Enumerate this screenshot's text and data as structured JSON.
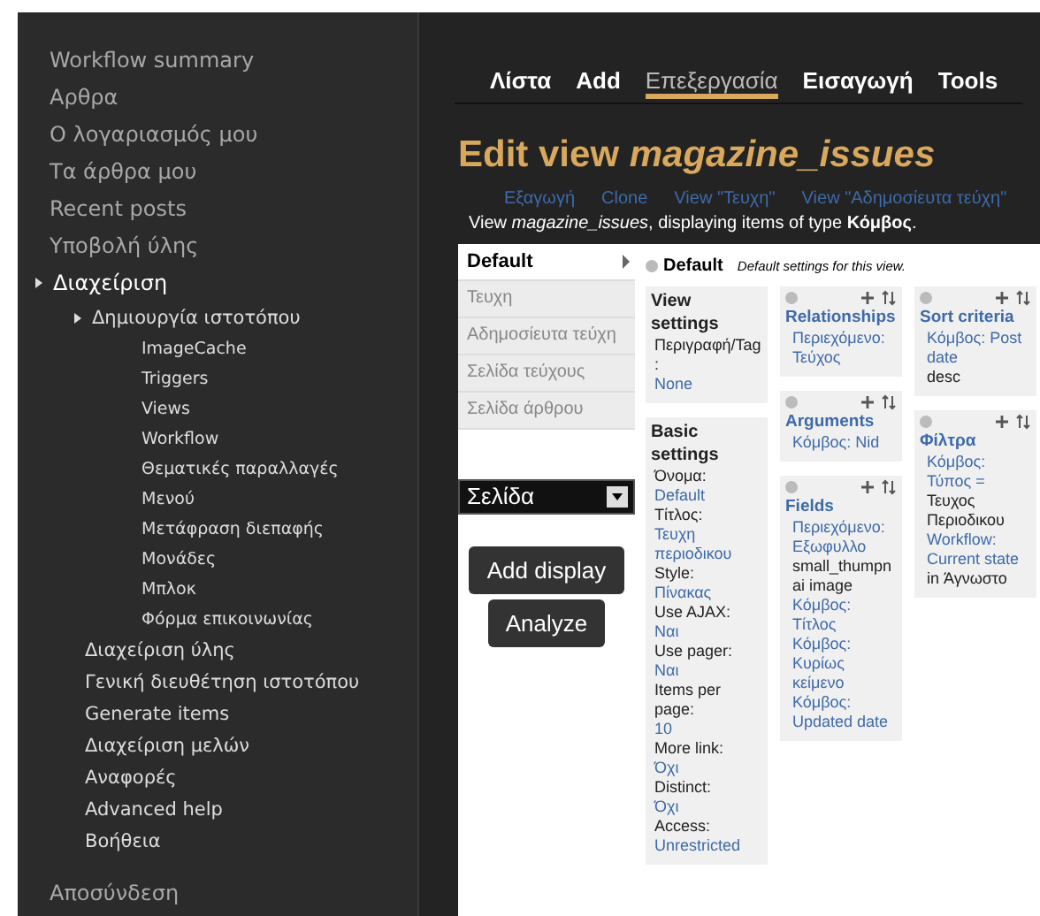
{
  "sidebar": {
    "items": [
      {
        "label": "Workflow summary"
      },
      {
        "label": "Αρθρα"
      },
      {
        "label": "Ο λογαριασμός μου"
      },
      {
        "label": "Τα άρθρα μου"
      },
      {
        "label": "Recent posts"
      },
      {
        "label": "Υποβολή ύλης"
      },
      {
        "label": "Διαχείριση",
        "children": [
          {
            "label": "Δημιουργία ιστοτόπου",
            "children": [
              {
                "label": "ImageCache"
              },
              {
                "label": "Triggers"
              },
              {
                "label": "Views"
              },
              {
                "label": "Workflow"
              },
              {
                "label": "Θεματικές παραλλαγές"
              },
              {
                "label": "Μενού"
              },
              {
                "label": "Μετάφραση διεπαφής"
              },
              {
                "label": "Μονάδες"
              },
              {
                "label": "Μπλοκ"
              },
              {
                "label": "Φόρμα επικοινωνίας"
              }
            ]
          },
          {
            "label": "Διαχείριση ύλης"
          },
          {
            "label": "Γενική διευθέτηση ιστοτόπου"
          },
          {
            "label": "Generate items"
          },
          {
            "label": "Διαχείριση μελών"
          },
          {
            "label": "Αναφορές"
          },
          {
            "label": "Advanced help"
          },
          {
            "label": "Βοήθεια"
          }
        ]
      },
      {
        "label": "Αποσύνδεση"
      }
    ]
  },
  "tabs": [
    {
      "label": "Λίστα",
      "selected": false
    },
    {
      "label": "Add",
      "selected": false
    },
    {
      "label": "Επεξεργασία",
      "selected": true
    },
    {
      "label": "Εισαγωγή",
      "selected": false
    },
    {
      "label": "Tools",
      "selected": false
    }
  ],
  "title": "Edit view *magazine_issues*",
  "links": [
    "Εξαγωγή",
    "Clone",
    "View \"Τευχη\"",
    "View \"Αδημοσίευτα τεύχη\""
  ],
  "description": "View *magazine_issues*, displaying items of type **Κόμβος**.",
  "displays": [
    {
      "label": "Default",
      "selected": true
    },
    {
      "label": "Τευχη",
      "selected": false
    },
    {
      "label": "Αδημοσίευτα τεύχη",
      "selected": false
    },
    {
      "label": "Σελίδα τεύχους",
      "selected": false
    },
    {
      "label": "Σελίδα άρθρου",
      "selected": false
    }
  ],
  "display_type": "Σελίδα",
  "buttons": [
    "Add display",
    "Analyze"
  ],
  "current": {
    "name": "Default",
    "note": "Default settings for this view."
  },
  "columns": [
    [
      {
        "kind": "settings",
        "title": "View settings",
        "entries": [
          [
            {
              "text": "Περιγραφή/Tag:",
              "link": false
            },
            {
              "text": "None",
              "link": true
            }
          ]
        ]
      },
      {
        "kind": "settings",
        "title": "Basic settings",
        "entries": [
          [
            {
              "text": "Όνομα:",
              "link": false
            },
            {
              "text": "Default",
              "link": true
            }
          ],
          [
            {
              "text": "Τίτλος:",
              "link": false
            },
            {
              "text": "Τευχη περιοδικου",
              "link": true
            }
          ],
          [
            {
              "text": "Style:",
              "link": false
            },
            {
              "text": "Πίνακας",
              "link": true
            }
          ],
          [
            {
              "text": "Use AJAX:",
              "link": false
            },
            {
              "text": "Ναι",
              "link": true
            }
          ],
          [
            {
              "text": "Use pager:",
              "link": false
            },
            {
              "text": "Ναι",
              "link": true
            }
          ],
          [
            {
              "text": "Items per page:",
              "link": false
            },
            {
              "text": "10",
              "link": true
            }
          ],
          [
            {
              "text": "More link:",
              "link": false
            },
            {
              "text": "Όχι",
              "link": true
            }
          ],
          [
            {
              "text": "Distinct:",
              "link": false
            },
            {
              "text": "Όχι",
              "link": true
            }
          ],
          [
            {
              "text": "Access:",
              "link": false
            },
            {
              "text": "Unrestricted",
              "link": true
            }
          ]
        ]
      }
    ],
    [
      {
        "kind": "section",
        "title": "Relationships",
        "entries": [
          [
            {
              "text": "Περιεχόμενο: Τεύχος",
              "link": true
            }
          ]
        ]
      },
      {
        "kind": "section",
        "title": "Arguments",
        "entries": [
          [
            {
              "text": "Κόμβος: Nid",
              "link": true
            }
          ]
        ]
      },
      {
        "kind": "section",
        "title": "Fields",
        "entries": [
          [
            {
              "text": "Περιεχόμενο: Εξωφυλλο",
              "link": true
            },
            {
              "text": "small_thumpnai image",
              "link": false
            }
          ],
          [
            {
              "text": "Κόμβος: Τίτλος",
              "link": true
            }
          ],
          [
            {
              "text": "Κόμβος: Κυρίως κείμενο",
              "link": true
            }
          ],
          [
            {
              "text": "Κόμβος: Updated date",
              "link": true
            }
          ]
        ]
      }
    ],
    [
      {
        "kind": "section",
        "title": "Sort criteria",
        "entries": [
          [
            {
              "text": "Κόμβος: Post date",
              "link": true
            },
            {
              "text": "desc",
              "link": false
            }
          ]
        ]
      },
      {
        "kind": "section",
        "title": "Φίλτρα",
        "entries": [
          [
            {
              "text": "Κόμβος: Τύπος =",
              "link": true
            },
            {
              "text": "Τευχος Περιοδικου",
              "link": false
            }
          ],
          [
            {
              "text": "Workflow: Current state",
              "link": true
            },
            {
              "text": "in Άγνωστο",
              "link": false
            }
          ]
        ]
      }
    ]
  ]
}
